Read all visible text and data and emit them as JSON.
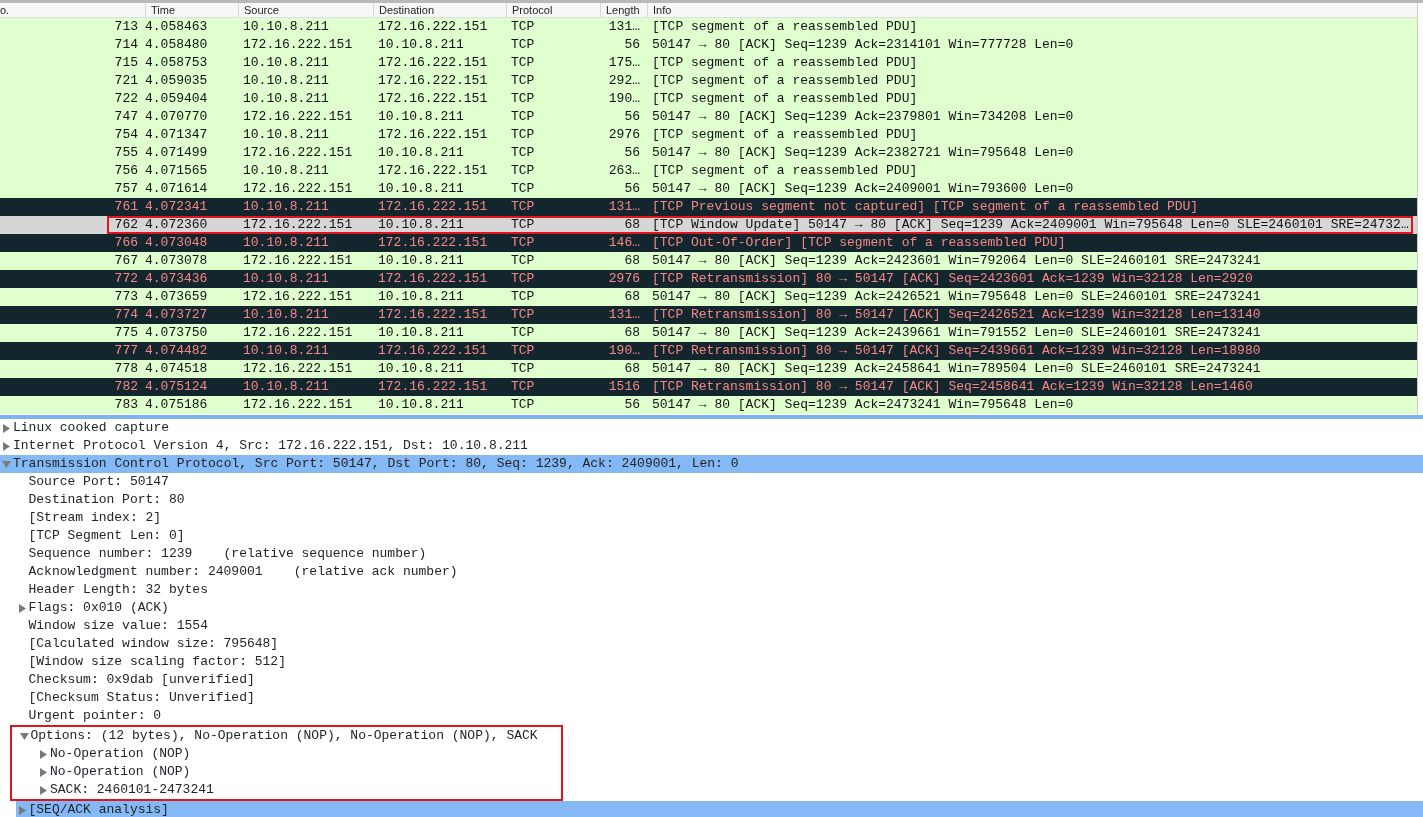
{
  "packet_list": {
    "columns": [
      "o.",
      "Time",
      "Source",
      "Destination",
      "Protocol",
      "Length",
      "Info"
    ],
    "rows": [
      {
        "kind": "normal",
        "selected": false,
        "outlined": false,
        "cells": [
          "713",
          "4.058463",
          "10.10.8.211",
          "172.16.222.151",
          "TCP",
          "131…",
          "[TCP segment of a reassembled PDU]"
        ]
      },
      {
        "kind": "normal",
        "selected": false,
        "outlined": false,
        "cells": [
          "714",
          "4.058480",
          "172.16.222.151",
          "10.10.8.211",
          "TCP",
          "56",
          "50147 → 80 [ACK] Seq=1239 Ack=2314101 Win=777728 Len=0"
        ]
      },
      {
        "kind": "normal",
        "selected": false,
        "outlined": false,
        "cells": [
          "715",
          "4.058753",
          "10.10.8.211",
          "172.16.222.151",
          "TCP",
          "175…",
          "[TCP segment of a reassembled PDU]"
        ]
      },
      {
        "kind": "normal",
        "selected": false,
        "outlined": false,
        "cells": [
          "721",
          "4.059035",
          "10.10.8.211",
          "172.16.222.151",
          "TCP",
          "292…",
          "[TCP segment of a reassembled PDU]"
        ]
      },
      {
        "kind": "normal",
        "selected": false,
        "outlined": false,
        "cells": [
          "722",
          "4.059404",
          "10.10.8.211",
          "172.16.222.151",
          "TCP",
          "190…",
          "[TCP segment of a reassembled PDU]"
        ]
      },
      {
        "kind": "normal",
        "selected": false,
        "outlined": false,
        "cells": [
          "747",
          "4.070770",
          "172.16.222.151",
          "10.10.8.211",
          "TCP",
          "56",
          "50147 → 80 [ACK] Seq=1239 Ack=2379801 Win=734208 Len=0"
        ]
      },
      {
        "kind": "normal",
        "selected": false,
        "outlined": false,
        "cells": [
          "754",
          "4.071347",
          "10.10.8.211",
          "172.16.222.151",
          "TCP",
          "2976",
          "[TCP segment of a reassembled PDU]"
        ]
      },
      {
        "kind": "normal",
        "selected": false,
        "outlined": false,
        "cells": [
          "755",
          "4.071499",
          "172.16.222.151",
          "10.10.8.211",
          "TCP",
          "56",
          "50147 → 80 [ACK] Seq=1239 Ack=2382721 Win=795648 Len=0"
        ]
      },
      {
        "kind": "normal",
        "selected": false,
        "outlined": false,
        "cells": [
          "756",
          "4.071565",
          "10.10.8.211",
          "172.16.222.151",
          "TCP",
          "263…",
          "[TCP segment of a reassembled PDU]"
        ]
      },
      {
        "kind": "normal",
        "selected": false,
        "outlined": false,
        "cells": [
          "757",
          "4.071614",
          "172.16.222.151",
          "10.10.8.211",
          "TCP",
          "56",
          "50147 → 80 [ACK] Seq=1239 Ack=2409001 Win=793600 Len=0"
        ]
      },
      {
        "kind": "error",
        "selected": false,
        "outlined": false,
        "cells": [
          "761",
          "4.072341",
          "10.10.8.211",
          "172.16.222.151",
          "TCP",
          "131…",
          "[TCP Previous segment not captured] [TCP segment of a reassembled PDU]"
        ]
      },
      {
        "kind": "normal",
        "selected": true,
        "outlined": true,
        "cells": [
          "762",
          "4.072360",
          "172.16.222.151",
          "10.10.8.211",
          "TCP",
          "68",
          "[TCP Window Update] 50147 → 80 [ACK] Seq=1239 Ack=2409001 Win=795648 Len=0 SLE=2460101 SRE=24732…"
        ]
      },
      {
        "kind": "error",
        "selected": false,
        "outlined": false,
        "cells": [
          "766",
          "4.073048",
          "10.10.8.211",
          "172.16.222.151",
          "TCP",
          "146…",
          "[TCP Out-Of-Order] [TCP segment of a reassembled PDU]"
        ]
      },
      {
        "kind": "normal",
        "selected": false,
        "outlined": false,
        "cells": [
          "767",
          "4.073078",
          "172.16.222.151",
          "10.10.8.211",
          "TCP",
          "68",
          "50147 → 80 [ACK] Seq=1239 Ack=2423601 Win=792064 Len=0 SLE=2460101 SRE=2473241"
        ]
      },
      {
        "kind": "error",
        "selected": false,
        "outlined": false,
        "cells": [
          "772",
          "4.073436",
          "10.10.8.211",
          "172.16.222.151",
          "TCP",
          "2976",
          "[TCP Retransmission] 80 → 50147 [ACK] Seq=2423601 Ack=1239 Win=32128 Len=2920"
        ]
      },
      {
        "kind": "normal",
        "selected": false,
        "outlined": false,
        "cells": [
          "773",
          "4.073659",
          "172.16.222.151",
          "10.10.8.211",
          "TCP",
          "68",
          "50147 → 80 [ACK] Seq=1239 Ack=2426521 Win=795648 Len=0 SLE=2460101 SRE=2473241"
        ]
      },
      {
        "kind": "error",
        "selected": false,
        "outlined": false,
        "cells": [
          "774",
          "4.073727",
          "10.10.8.211",
          "172.16.222.151",
          "TCP",
          "131…",
          "[TCP Retransmission] 80 → 50147 [ACK] Seq=2426521 Ack=1239 Win=32128 Len=13140"
        ]
      },
      {
        "kind": "normal",
        "selected": false,
        "outlined": false,
        "cells": [
          "775",
          "4.073750",
          "172.16.222.151",
          "10.10.8.211",
          "TCP",
          "68",
          "50147 → 80 [ACK] Seq=1239 Ack=2439661 Win=791552 Len=0 SLE=2460101 SRE=2473241"
        ]
      },
      {
        "kind": "error",
        "selected": false,
        "outlined": false,
        "cells": [
          "777",
          "4.074482",
          "10.10.8.211",
          "172.16.222.151",
          "TCP",
          "190…",
          "[TCP Retransmission] 80 → 50147 [ACK] Seq=2439661 Ack=1239 Win=32128 Len=18980"
        ]
      },
      {
        "kind": "normal",
        "selected": false,
        "outlined": false,
        "cells": [
          "778",
          "4.074518",
          "172.16.222.151",
          "10.10.8.211",
          "TCP",
          "68",
          "50147 → 80 [ACK] Seq=1239 Ack=2458641 Win=789504 Len=0 SLE=2460101 SRE=2473241"
        ]
      },
      {
        "kind": "error",
        "selected": false,
        "outlined": false,
        "cells": [
          "782",
          "4.075124",
          "10.10.8.211",
          "172.16.222.151",
          "TCP",
          "1516",
          "[TCP Retransmission] 80 → 50147 [ACK] Seq=2458641 Ack=1239 Win=32128 Len=1460"
        ]
      },
      {
        "kind": "normal",
        "selected": false,
        "outlined": false,
        "cells": [
          "783",
          "4.075186",
          "172.16.222.151",
          "10.10.8.211",
          "TCP",
          "56",
          "50147 → 80 [ACK] Seq=1239 Ack=2473241 Win=795648 Len=0"
        ]
      }
    ]
  },
  "packet_details": [
    {
      "label": "Linux cooked capture",
      "expanded": false,
      "selected": false
    },
    {
      "label": "Internet Protocol Version 4, Src: 172.16.222.151, Dst: 10.10.8.211",
      "expanded": false,
      "selected": false
    },
    {
      "label": "Transmission Control Protocol, Src Port: 50147, Dst Port: 80, Seq: 1239, Ack: 2409001, Len: 0",
      "expanded": true,
      "selected": true,
      "children": [
        {
          "label": "Source Port: 50147",
          "selected": false
        },
        {
          "label": "Destination Port: 80",
          "selected": false
        },
        {
          "label": "[Stream index: 2]",
          "selected": false
        },
        {
          "label": "[TCP Segment Len: 0]",
          "selected": false
        },
        {
          "label": "Sequence number: 1239    (relative sequence number)",
          "selected": false
        },
        {
          "label": "Acknowledgment number: 2409001    (relative ack number)",
          "selected": false
        },
        {
          "label": "Header Length: 32 bytes",
          "selected": false
        },
        {
          "label": "Flags: 0x010 (ACK)",
          "expanded": false,
          "selected": false
        },
        {
          "label": "Window size value: 1554",
          "selected": false
        },
        {
          "label": "[Calculated window size: 795648]",
          "selected": false
        },
        {
          "label": "[Window size scaling factor: 512]",
          "selected": false
        },
        {
          "label": "Checksum: 0x9dab [unverified]",
          "selected": false
        },
        {
          "label": "[Checksum Status: Unverified]",
          "selected": false
        },
        {
          "label": "Urgent pointer: 0",
          "selected": false
        },
        {
          "label": "Options: (12 bytes), No-Operation (NOP), No-Operation (NOP), SACK",
          "expanded": true,
          "selected": false,
          "outlined": true,
          "children": [
            {
              "label": "No-Operation (NOP)",
              "expanded": false,
              "selected": false
            },
            {
              "label": "No-Operation (NOP)",
              "expanded": false,
              "selected": false
            },
            {
              "label": "SACK: 2460101-2473241",
              "expanded": false,
              "selected": false
            }
          ]
        },
        {
          "label": "[SEQ/ACK analysis]",
          "expanded": false,
          "selected": true
        }
      ]
    }
  ]
}
